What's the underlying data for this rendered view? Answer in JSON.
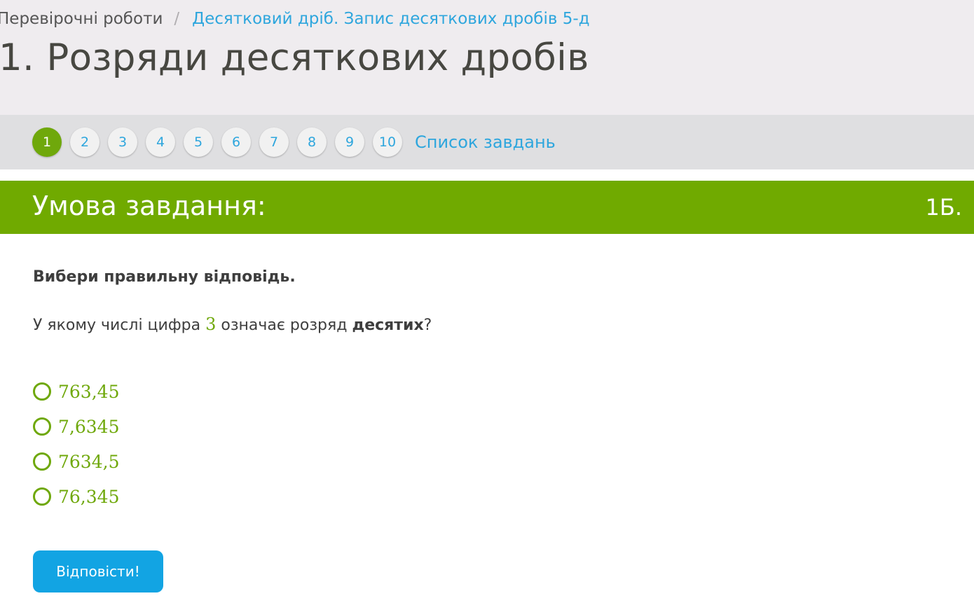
{
  "breadcrumb": {
    "parent": "Перевірочні роботи",
    "separator": "/",
    "current": "Десятковий дріб. Запис десяткових дробів 5-д"
  },
  "page_title": "1. Розряди десяткових дробів",
  "pager": {
    "pages": [
      "1",
      "2",
      "3",
      "4",
      "5",
      "6",
      "7",
      "8",
      "9",
      "10"
    ],
    "active_page": "1",
    "task_list_label": "Список завдань"
  },
  "task": {
    "header_title": "Умова завдання:",
    "points": "1Б.",
    "instruction": "Вибери правильну відповідь.",
    "question": {
      "part1": "У якому числі цифра ",
      "digit": "3",
      "part2": " означає розряд ",
      "emphasis": "десятих",
      "part3": "?"
    },
    "options": [
      "763,45",
      "7,6345",
      "7634,5",
      "76,345"
    ],
    "submit_label": "Відповісти!"
  },
  "colors": {
    "accent_green": "#70aa00",
    "link_blue": "#2ea6dd",
    "button_blue": "#12a4e3"
  }
}
